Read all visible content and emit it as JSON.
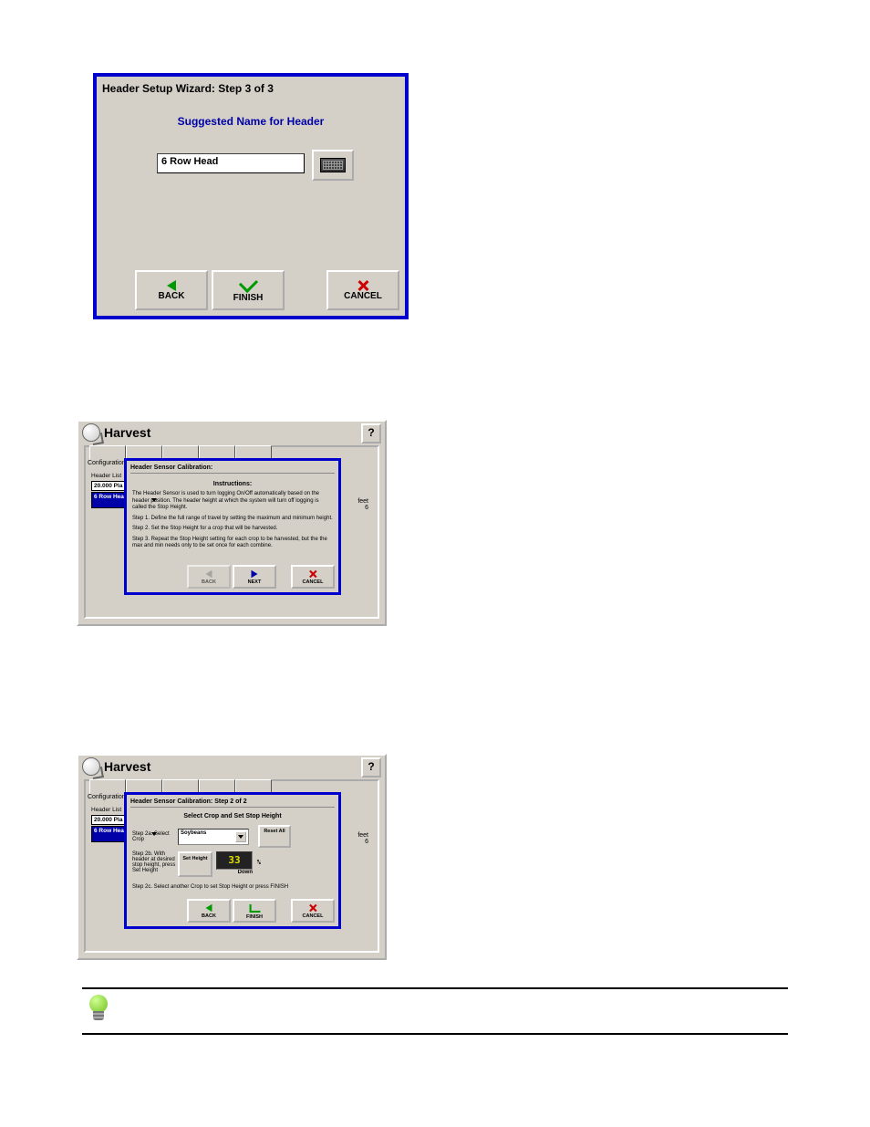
{
  "wizard1": {
    "title": "Header Setup Wizard:  Step 3 of 3",
    "subtitle": "Suggested Name for Header",
    "input_value": "6 Row Head",
    "back": "BACK",
    "finish": "FINISH",
    "cancel": "CANCEL"
  },
  "harvest": {
    "title": "Harvest",
    "help": "?",
    "configuration_tab": "Configuration",
    "header_list_label": "Header List",
    "header_list": [
      "20.000 Pla",
      "6 Row Hea"
    ],
    "feet_label": "feet",
    "feet_value": "6"
  },
  "calibration1": {
    "title": "Header Sensor Calibration:",
    "instructions_label": "Instructions:",
    "p1": "The Header Sensor is used to turn logging On/Off automatically based on the header position.  The header height at which the system will turn off logging is called the Stop Height.",
    "p2": "Step 1.  Define the full range of travel by setting the maximum and minimum height.",
    "p3": "Step 2.  Set the Stop Height for a crop that will be harvested.",
    "p4": "Step 3.  Repeat the Stop Height setting for each crop to be harvested, but the the max and min needs only to be set once for each combine.",
    "back": "BACK",
    "next": "NEXT",
    "cancel": "CANCEL"
  },
  "calibration2": {
    "title": "Header Sensor Calibration:  Step 2 of 2",
    "subtitle": "Select Crop and Set Stop Height",
    "step2a_label": "Step 2a.  Select Crop",
    "crop_value": "Soybeans",
    "reset_label": "Reset All",
    "step2b_label": "Step 2b.  With header at desired stop height, press Set Height",
    "set_height_btn": "Set Height",
    "readout": "33",
    "down": "Down",
    "step2c": "Step 2c.  Select another Crop to set Stop Height or press FINISH",
    "back": "BACK",
    "finish": "FINISH",
    "cancel": "CANCEL"
  }
}
